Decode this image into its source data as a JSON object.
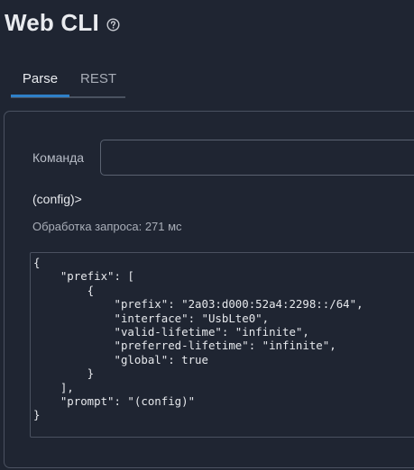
{
  "header": {
    "title": "Web CLI",
    "help_icon": "question-circle-icon"
  },
  "tabs": [
    {
      "label": "Parse",
      "active": true
    },
    {
      "label": "REST",
      "active": false
    }
  ],
  "command": {
    "label": "Команда",
    "value": ""
  },
  "prompt": "(config)>",
  "status": "Обработка запроса: 271 мс",
  "output": "{\n    \"prefix\": [\n        {\n            \"prefix\": \"2a03:d000:52a4:2298::/64\",\n            \"interface\": \"UsbLte0\",\n            \"valid-lifetime\": \"infinite\",\n            \"preferred-lifetime\": \"infinite\",\n            \"global\": true\n        }\n    ],\n    \"prompt\": \"(config)\"\n}",
  "colors": {
    "background": "#1f2532",
    "accent": "#2f80c8",
    "border": "#4a5160"
  }
}
